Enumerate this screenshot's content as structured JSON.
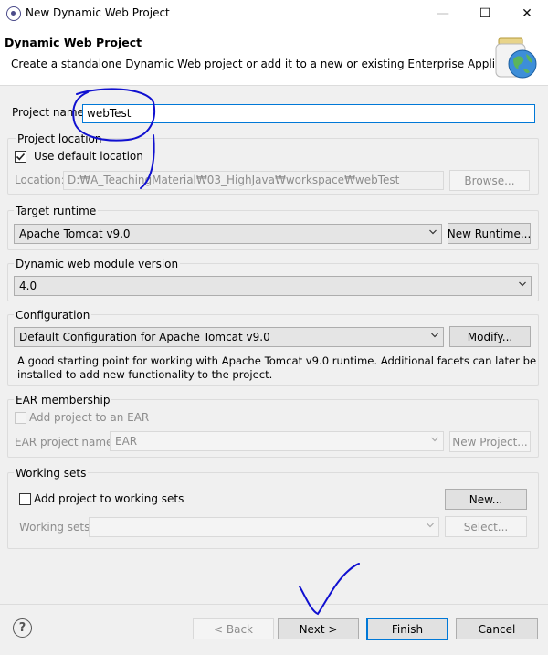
{
  "window": {
    "title": "New Dynamic Web Project",
    "minimize": "—",
    "maximize": "☐",
    "close": "✕"
  },
  "header": {
    "title": "Dynamic Web Project",
    "description": "Create a standalone Dynamic Web project or add it to a new or existing Enterprise Application."
  },
  "project_name": {
    "label": "Project name:",
    "value": "webTest"
  },
  "project_location": {
    "title": "Project location",
    "use_default_label": "Use default location",
    "use_default_checked": true,
    "location_label": "Location:",
    "location_value": "D:₩A_TeachingMaterial₩03_HighJava₩workspace₩webTest",
    "browse_label": "Browse..."
  },
  "target_runtime": {
    "title": "Target runtime",
    "selected": "Apache Tomcat v9.0",
    "new_runtime_label": "New Runtime..."
  },
  "module_version": {
    "title": "Dynamic web module version",
    "selected": "4.0"
  },
  "configuration": {
    "title": "Configuration",
    "selected": "Default Configuration for Apache Tomcat v9.0",
    "modify_label": "Modify...",
    "description_line1": "A good starting point for working with Apache Tomcat v9.0 runtime. Additional facets can later be",
    "description_line2": "installed to add new functionality to the project."
  },
  "ear": {
    "title": "EAR membership",
    "add_label": "Add project to an EAR",
    "project_name_label": "EAR project name:",
    "project_name_value": "EAR",
    "new_project_label": "New Project..."
  },
  "working_sets": {
    "title": "Working sets",
    "add_label": "Add project to working sets",
    "new_label": "New...",
    "sets_label": "Working sets:",
    "select_label": "Select..."
  },
  "footer": {
    "help": "?",
    "back_label": "< Back",
    "next_label": "Next >",
    "finish_label": "Finish",
    "cancel_label": "Cancel"
  },
  "annotations": {
    "ink_color": "#1010d0"
  }
}
